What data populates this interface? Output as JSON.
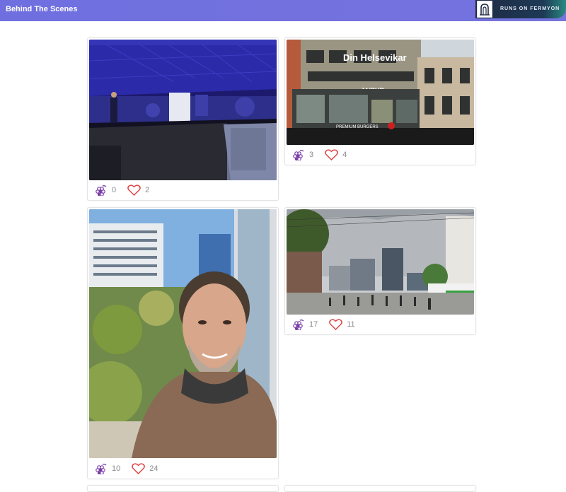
{
  "header": {
    "title": "Behind The Scenes",
    "badge_text": "RUNS ON FERMYON",
    "accent_color": "#7272de"
  },
  "posts": [
    {
      "grapes": "0",
      "likes": "2",
      "photo": "conference stage with speaker"
    },
    {
      "grapes": "3",
      "likes": "4",
      "photo": "Din Helsevikar building with Jaipur restaurant"
    },
    {
      "grapes": "10",
      "likes": "24",
      "photo": "selfie in front of office window"
    },
    {
      "grapes": "17",
      "likes": "11",
      "photo": "crowded city street"
    }
  ],
  "icons": {
    "grape": "grape-icon",
    "like": "heart-icon",
    "logo": "fermyon-logo"
  }
}
